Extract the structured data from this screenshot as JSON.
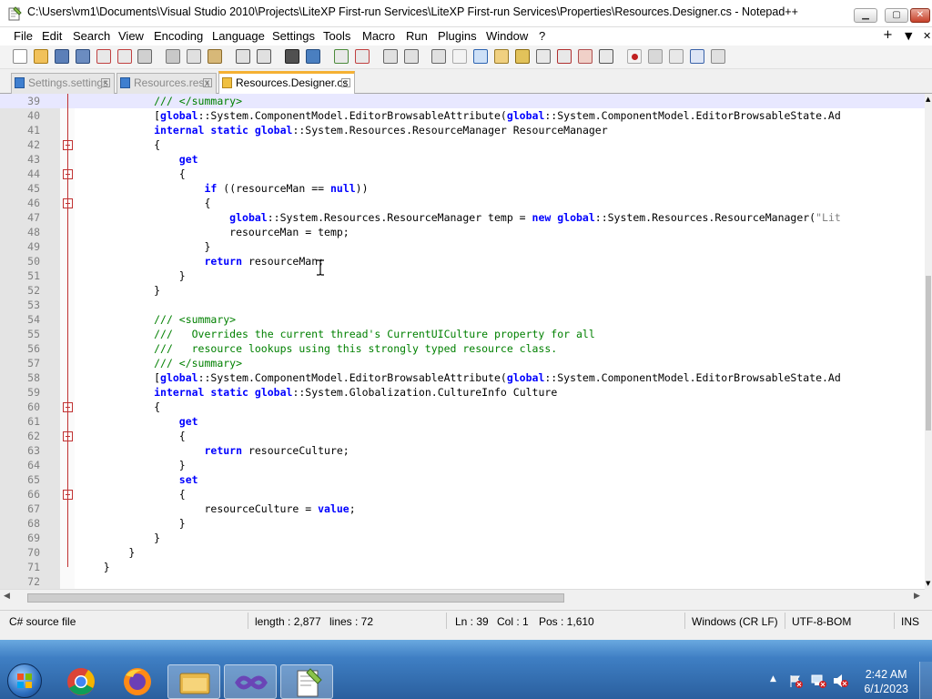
{
  "window": {
    "title": "C:\\Users\\vm1\\Documents\\Visual Studio 2010\\Projects\\LiteXP First-run Services\\LiteXP First-run Services\\Properties\\Resources.Designer.cs - Notepad++",
    "minimize": "▁",
    "maximize": "▢",
    "close": "✕"
  },
  "menu": {
    "items": [
      "File",
      "Edit",
      "Search",
      "View",
      "Encoding",
      "Language",
      "Settings",
      "Tools",
      "Macro",
      "Run",
      "Plugins",
      "Window",
      "?"
    ],
    "right": [
      "+",
      "▼",
      "✕"
    ]
  },
  "tabs": [
    {
      "label": "Settings.settings",
      "active": false
    },
    {
      "label": "Resources.resx",
      "active": false
    },
    {
      "label": "Resources.Designer.cs",
      "active": true
    }
  ],
  "editor": {
    "current_line": 39,
    "lines": [
      {
        "n": "39",
        "code": "            /// </summary>"
      },
      {
        "n": "40",
        "code": "            [global::System.ComponentModel.EditorBrowsableAttribute(global::System.ComponentModel.EditorBrowsableState.Ad"
      },
      {
        "n": "41",
        "code": "            internal static global::System.Resources.ResourceManager ResourceManager"
      },
      {
        "n": "42",
        "code": "            {"
      },
      {
        "n": "43",
        "code": "                get"
      },
      {
        "n": "44",
        "code": "                {"
      },
      {
        "n": "45",
        "code": "                    if ((resourceMan == null))"
      },
      {
        "n": "46",
        "code": "                    {"
      },
      {
        "n": "47",
        "code": "                        global::System.Resources.ResourceManager temp = new global::System.Resources.ResourceManager(\"Lit"
      },
      {
        "n": "48",
        "code": "                        resourceMan = temp;"
      },
      {
        "n": "49",
        "code": "                    }"
      },
      {
        "n": "50",
        "code": "                    return resourceMan;"
      },
      {
        "n": "51",
        "code": "                }"
      },
      {
        "n": "52",
        "code": "            }"
      },
      {
        "n": "53",
        "code": ""
      },
      {
        "n": "54",
        "code": "            /// <summary>"
      },
      {
        "n": "55",
        "code": "            ///   Overrides the current thread's CurrentUICulture property for all"
      },
      {
        "n": "56",
        "code": "            ///   resource lookups using this strongly typed resource class."
      },
      {
        "n": "57",
        "code": "            /// </summary>"
      },
      {
        "n": "58",
        "code": "            [global::System.ComponentModel.EditorBrowsableAttribute(global::System.ComponentModel.EditorBrowsableState.Ad"
      },
      {
        "n": "59",
        "code": "            internal static global::System.Globalization.CultureInfo Culture"
      },
      {
        "n": "60",
        "code": "            {"
      },
      {
        "n": "61",
        "code": "                get"
      },
      {
        "n": "62",
        "code": "                {"
      },
      {
        "n": "63",
        "code": "                    return resourceCulture;"
      },
      {
        "n": "64",
        "code": "                }"
      },
      {
        "n": "65",
        "code": "                set"
      },
      {
        "n": "66",
        "code": "                {"
      },
      {
        "n": "67",
        "code": "                    resourceCulture = value;"
      },
      {
        "n": "68",
        "code": "                }"
      },
      {
        "n": "69",
        "code": "            }"
      },
      {
        "n": "70",
        "code": "        }"
      },
      {
        "n": "71",
        "code": "    }"
      },
      {
        "n": "72",
        "code": ""
      }
    ]
  },
  "status": {
    "file_type": "C# source file",
    "length": "length : 2,877",
    "lines": "lines : 72",
    "ln": "Ln : 39",
    "col": "Col : 1",
    "pos": "Pos : 1,610",
    "eol": "Windows (CR LF)",
    "encoding": "UTF-8-BOM",
    "mode": "INS"
  },
  "taskbar": {
    "apps": [
      "start-button",
      "chrome",
      "firefox",
      "file-explorer",
      "visual-studio",
      "notepad-plus-plus"
    ],
    "time": "2:42 AM",
    "date": "6/1/2023"
  },
  "colors": {
    "keyword": "#0000ff",
    "comment": "#008000",
    "active_tab_accent": "#f5b133",
    "current_line": "#e8e8ff"
  }
}
